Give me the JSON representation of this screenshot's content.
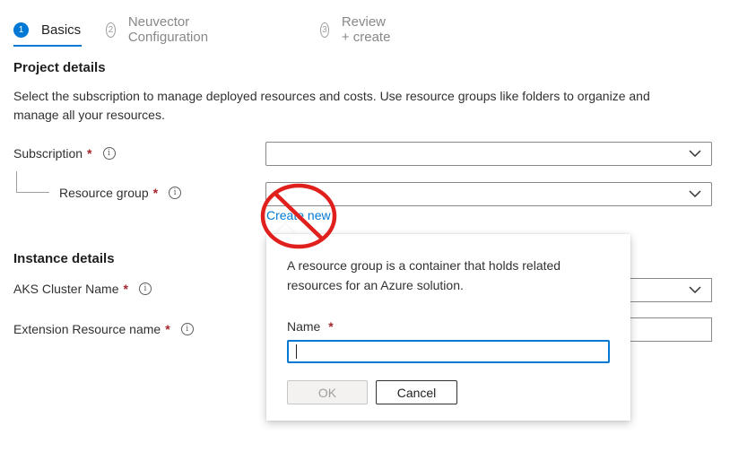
{
  "tabs": [
    {
      "step": "1",
      "label": "Basics"
    },
    {
      "step": "2",
      "label": "Neuvector Configuration"
    },
    {
      "step": "3",
      "label": "Review + create"
    }
  ],
  "project": {
    "title": "Project details",
    "description": "Select the subscription to manage deployed resources and costs. Use resource groups like folders to organize and manage all your resources.",
    "subscription_label": "Subscription",
    "resource_group_label": "Resource group",
    "create_new": "Create new"
  },
  "instance": {
    "title": "Instance details",
    "aks_label": "AKS Cluster Name",
    "extension_label": "Extension Resource name"
  },
  "required_mark": "*",
  "info_glyph": "i",
  "callout": {
    "text": "A resource group is a container that holds related resources for an Azure solution.",
    "name_label": "Name",
    "name_value": "",
    "ok_label": "OK",
    "cancel_label": "Cancel"
  },
  "colors": {
    "accent": "#0078d4",
    "required": "#a4262c",
    "no_symbol": "#e0201c"
  },
  "icons": {
    "dropdown": "chevron-down-icon",
    "info": "info-icon",
    "overlay": "no-symbol-icon"
  }
}
